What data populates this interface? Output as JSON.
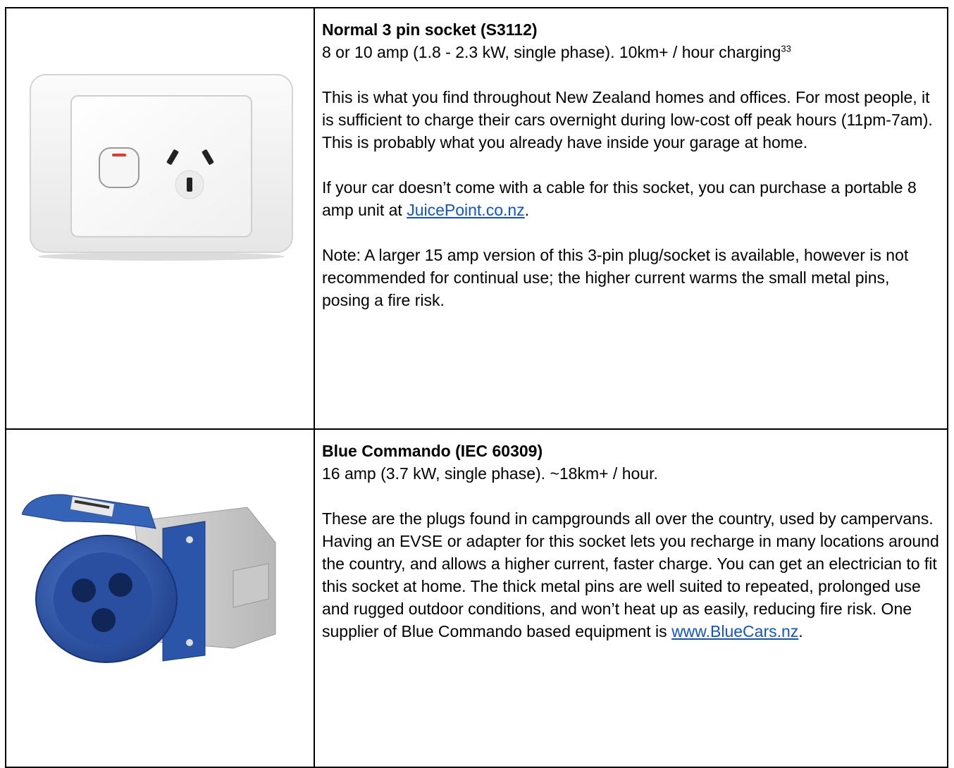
{
  "rows": [
    {
      "image_icon": "three-pin-wall-socket-icon",
      "title": "Normal 3 pin socket (S3112)",
      "spec": "8 or 10 amp (1.8 - 2.3 kW, single phase). 10km+ / hour charging",
      "footnote": "33",
      "p1": "This is what you find throughout New Zealand homes and offices. For most people, it is sufficient to charge their cars overnight during low-cost off peak hours (11pm-7am). This is probably what you already have inside your garage at home.",
      "p2_before": "If your car doesn’t come with a cable for this socket, you can purchase a portable 8 amp unit at ",
      "p2_link": "JuicePoint.co.nz",
      "p2_after": ".",
      "p3": "Note: A larger 15 amp version of this 3-pin plug/socket is available, however is not recommended for continual use; the higher current warms the small metal pins, posing a fire risk."
    },
    {
      "image_icon": "blue-commando-socket-icon",
      "title": "Blue Commando (IEC 60309)",
      "spec": "16 amp (3.7 kW, single phase). ~18km+ / hour.",
      "p1_before": "These are the plugs found in campgrounds all over the country, used by campervans. Having an EVSE or adapter for this socket lets you recharge in many locations around the country, and allows a higher current, faster charge. You can get an electrician to fit this socket at home. The thick metal pins are well suited to repeated, prolonged use and rugged outdoor conditions, and won’t heat up as easily, reducing fire risk. One supplier of Blue Commando based equipment is ",
      "p1_link": "www.BlueCars.nz",
      "p1_after": "."
    }
  ],
  "colors": {
    "link": "#1155cc",
    "commando_blue": "#2b55a8",
    "border": "#000000"
  }
}
